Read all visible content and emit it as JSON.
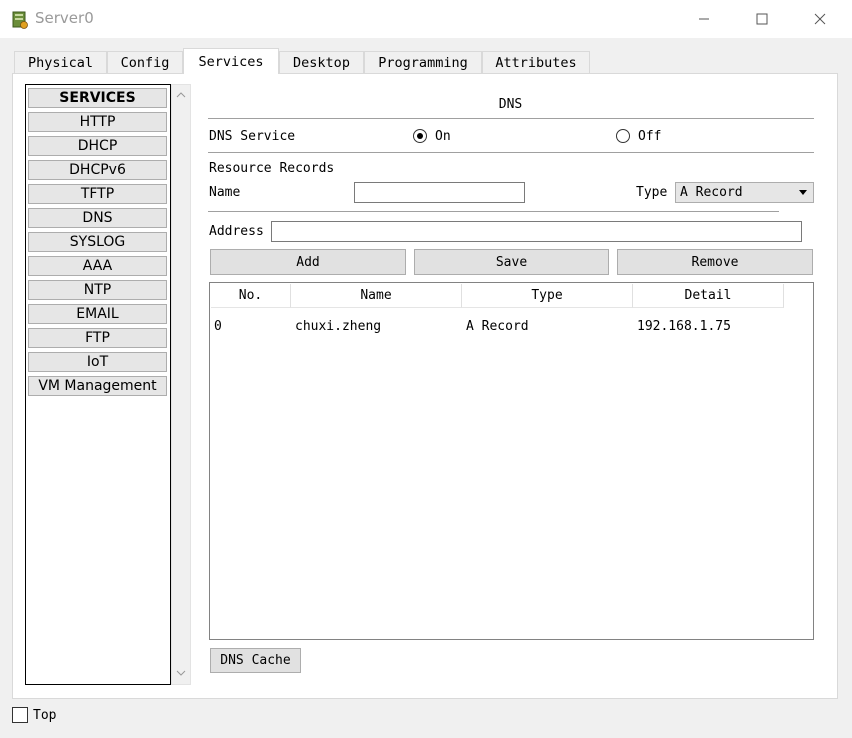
{
  "window": {
    "title": "Server0",
    "controls": {
      "minimize": "—",
      "maximize": "☐",
      "close": "✕"
    }
  },
  "tabs": [
    {
      "label": "Physical",
      "active": false
    },
    {
      "label": "Config",
      "active": false
    },
    {
      "label": "Services",
      "active": true
    },
    {
      "label": "Desktop",
      "active": false
    },
    {
      "label": "Programming",
      "active": false
    },
    {
      "label": "Attributes",
      "active": false
    }
  ],
  "services": {
    "header": "SERVICES",
    "items": [
      "HTTP",
      "DHCP",
      "DHCPv6",
      "TFTP",
      "DNS",
      "SYSLOG",
      "AAA",
      "NTP",
      "EMAIL",
      "FTP",
      "IoT",
      "VM Management"
    ]
  },
  "dns": {
    "heading": "DNS",
    "service_label": "DNS Service",
    "on_label": "On",
    "off_label": "Off",
    "service_state": "On",
    "resource_records_label": "Resource Records",
    "name_label": "Name",
    "name_value": "",
    "type_label": "Type",
    "type_value": "A Record",
    "address_label": "Address",
    "address_value": "",
    "add_label": "Add",
    "save_label": "Save",
    "remove_label": "Remove",
    "table": {
      "columns": [
        "No.",
        "Name",
        "Type",
        "Detail"
      ],
      "rows": [
        [
          "0",
          "chuxi.zheng",
          "A Record",
          "192.168.1.75"
        ]
      ]
    },
    "cache_label": "DNS Cache"
  },
  "footer": {
    "top_label": "Top",
    "top_checked": false
  },
  "colors": {
    "window_bg": "#f0f0f0",
    "panel_bg": "#ffffff",
    "button_bg": "#e1e1e1",
    "title_text": "#9a9a9a"
  }
}
